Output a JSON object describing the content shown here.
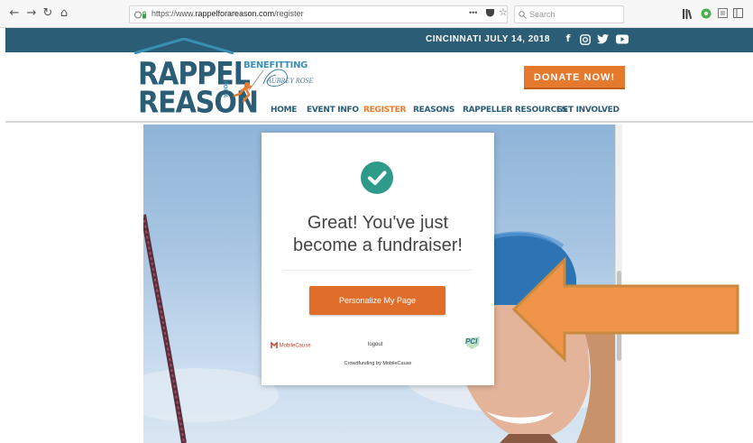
{
  "browser": {
    "url_prefix": "https://www.",
    "url_host": "rappelforareason.com",
    "url_path": "/register",
    "search_placeholder": "Search"
  },
  "site": {
    "event_banner": "CINCINNATI JULY 14, 2018",
    "logo_line1": "RAPPEL",
    "logo_line2": "REASON",
    "logo_for_a": "FOR A",
    "benefitting": "BENEFITTING",
    "beneficiary": "AUBREY ROSE",
    "donate_label": "DONATE NOW!",
    "nav": [
      {
        "label": "HOME",
        "active": false
      },
      {
        "label": "EVENT INFO",
        "active": false
      },
      {
        "label": "REGISTER",
        "active": true
      },
      {
        "label": "REASONS",
        "active": false
      },
      {
        "label": "RAPPELLER RESOURCES",
        "active": false
      },
      {
        "label": "GET INVOLVED",
        "active": false
      }
    ]
  },
  "card": {
    "heading_line1": "Great! You've just",
    "heading_line2": "become a fundraiser!",
    "button_label": "Personalize My Page",
    "partner_logo": "MobileCause",
    "logout_label": "logout",
    "pci_badge": "PCI",
    "powered_by": "Crowdfunding by MobileCause"
  },
  "colors": {
    "brand_blue": "#2b5d77",
    "accent_orange": "#e57a2e",
    "check_teal": "#2e9a8a",
    "arrow_orange": "#f0944a"
  },
  "icons": {
    "back": "arrow-left-icon",
    "forward": "arrow-right-icon",
    "reload": "reload-icon",
    "home": "home-icon",
    "facebook": "facebook-icon",
    "instagram": "instagram-icon",
    "twitter": "twitter-icon",
    "youtube": "youtube-icon",
    "success": "checkmark-icon"
  }
}
